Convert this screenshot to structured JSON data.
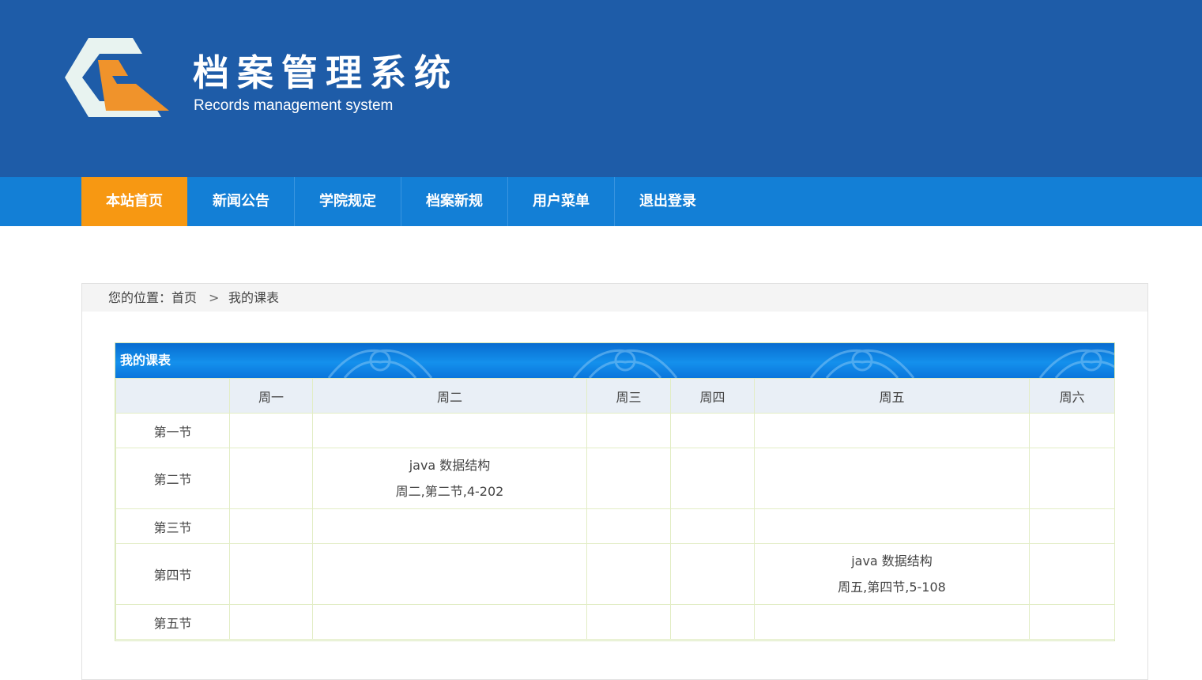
{
  "header": {
    "title": "档案管理系统",
    "subtitle": "Records management system",
    "colors": {
      "background": "#1e5ca8",
      "logo_orange": "#f0932b",
      "logo_light": "#e8f3f0"
    }
  },
  "nav": {
    "items": [
      {
        "label": "本站首页",
        "active": true
      },
      {
        "label": "新闻公告"
      },
      {
        "label": "学院规定"
      },
      {
        "label": "档案新规"
      },
      {
        "label": "用户菜单"
      },
      {
        "label": "退出登录"
      }
    ],
    "colors": {
      "bar": "#137fd6",
      "active": "#f79812"
    }
  },
  "breadcrumb": {
    "prefix": "您的位置：",
    "home": "首页",
    "separator": ">",
    "current": "我的课表"
  },
  "schedule": {
    "title": "我的课表",
    "days": [
      "周一",
      "周二",
      "周三",
      "周四",
      "周五",
      "周六"
    ],
    "rows": [
      {
        "label": "第一节",
        "cells": [
          "",
          "",
          "",
          "",
          "",
          ""
        ]
      },
      {
        "label": "第二节",
        "cells": [
          "",
          {
            "name": "java 数据结构",
            "info": "周二,第二节,4-202"
          },
          "",
          "",
          "",
          ""
        ]
      },
      {
        "label": "第三节",
        "cells": [
          "",
          "",
          "",
          "",
          "",
          ""
        ]
      },
      {
        "label": "第四节",
        "cells": [
          "",
          "",
          "",
          "",
          {
            "name": "java 数据结构",
            "info": "周五,第四节,5-108"
          },
          ""
        ]
      },
      {
        "label": "第五节",
        "cells": [
          "",
          "",
          "",
          "",
          "",
          ""
        ]
      }
    ]
  }
}
